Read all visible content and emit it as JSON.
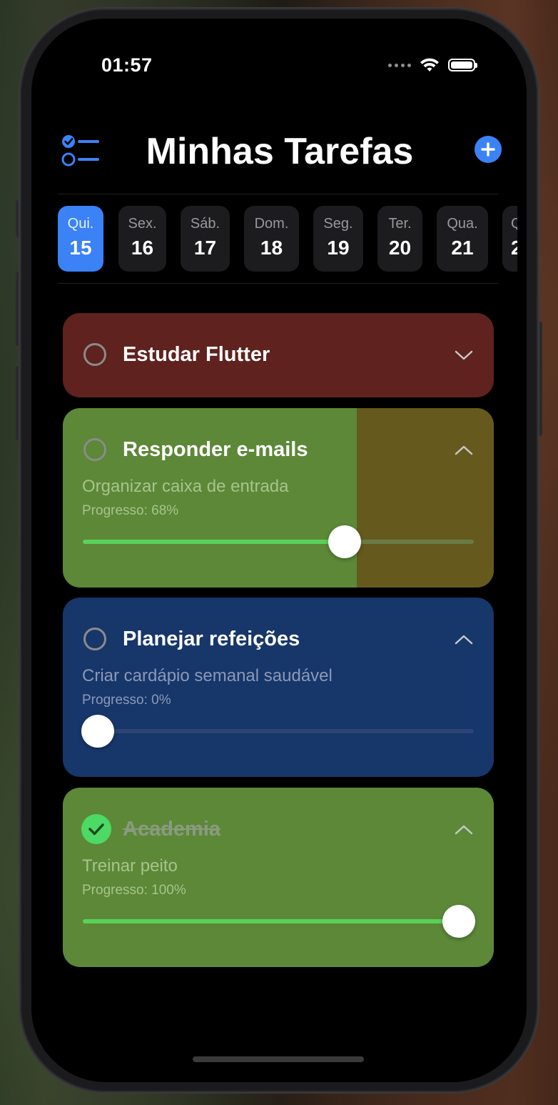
{
  "status_bar": {
    "time": "01:57"
  },
  "header": {
    "title": "Minhas Tarefas"
  },
  "colors": {
    "accent": "#3b82f6",
    "task_red": "#5f221e",
    "task_green": "#5c8838",
    "task_blue": "#17366a",
    "task_olive": "#66591e",
    "progress_green": "#5ad15a"
  },
  "dates": [
    {
      "day": "Qui.",
      "num": "15",
      "selected": true
    },
    {
      "day": "Sex.",
      "num": "16"
    },
    {
      "day": "Sáb.",
      "num": "17"
    },
    {
      "day": "Dom.",
      "num": "18"
    },
    {
      "day": "Seg.",
      "num": "19"
    },
    {
      "day": "Ter.",
      "num": "20"
    },
    {
      "day": "Qua.",
      "num": "21"
    },
    {
      "day": "Q",
      "num": "2"
    }
  ],
  "tasks": [
    {
      "title": "Estudar Flutter",
      "expanded": false,
      "done": false
    },
    {
      "title": "Responder e-mails",
      "description": "Organizar caixa de entrada",
      "progress_label": "Progresso: 68%",
      "progress": 0.68,
      "expanded": true,
      "done": false
    },
    {
      "title": "Planejar refeições",
      "description": "Criar cardápio semanal saudável",
      "progress_label": "Progresso: 0%",
      "progress": 0,
      "expanded": true,
      "done": false
    },
    {
      "title": "Academia",
      "description": "Treinar peito",
      "progress_label": "Progresso: 100%",
      "progress": 1,
      "expanded": true,
      "done": true
    }
  ]
}
